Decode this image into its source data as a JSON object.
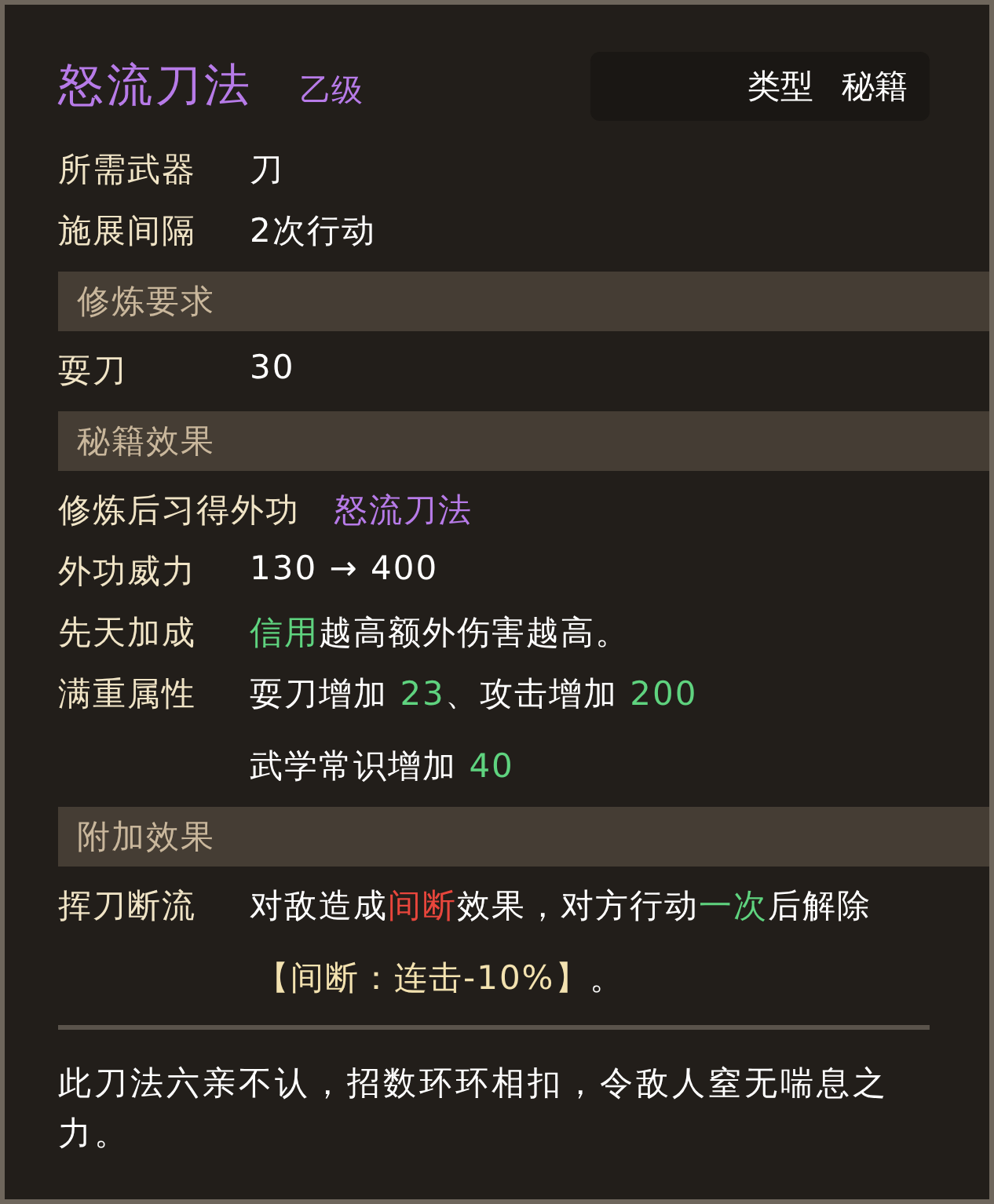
{
  "title": {
    "name": "怒流刀法",
    "grade": "乙级"
  },
  "type_chip": {
    "label": "类型",
    "value": "秘籍"
  },
  "blocks": [
    {
      "kind": "row",
      "label": "所需武器",
      "lines": [
        [
          {
            "text": "刀",
            "color": "#ffffff"
          }
        ]
      ]
    },
    {
      "kind": "row",
      "label": "施展间隔",
      "lines": [
        [
          {
            "text": "2次行动",
            "color": "#ffffff"
          }
        ]
      ]
    },
    {
      "kind": "header",
      "label": "修炼要求"
    },
    {
      "kind": "row",
      "label": "耍刀",
      "lines": [
        [
          {
            "text": "30",
            "color": "#ffffff"
          }
        ]
      ]
    },
    {
      "kind": "header",
      "label": "秘籍效果"
    },
    {
      "kind": "row",
      "label": "修炼后习得外功",
      "lines": [
        [
          {
            "text": "怒流刀法",
            "color": "#b77be8"
          }
        ]
      ]
    },
    {
      "kind": "row",
      "label": "外功威力",
      "lines": [
        [
          {
            "text": "130 → 400",
            "color": "#ffffff"
          }
        ]
      ]
    },
    {
      "kind": "row",
      "label": "先天加成",
      "lines": [
        [
          {
            "text": "信用",
            "color": "#5fd37f"
          },
          {
            "text": "越高额外伤害越高。",
            "color": "#ffffff"
          }
        ]
      ]
    },
    {
      "kind": "row",
      "label": "满重属性",
      "lines": [
        [
          {
            "text": "耍刀增加 ",
            "color": "#ffffff"
          },
          {
            "text": "23",
            "color": "#5fd37f"
          },
          {
            "text": "、攻击增加 ",
            "color": "#ffffff"
          },
          {
            "text": "200",
            "color": "#5fd37f"
          }
        ],
        [
          {
            "text": "武学常识增加 ",
            "color": "#ffffff"
          },
          {
            "text": "40",
            "color": "#5fd37f"
          }
        ]
      ]
    },
    {
      "kind": "header",
      "label": "附加效果"
    },
    {
      "kind": "row",
      "label": "挥刀断流",
      "lines": [
        [
          {
            "text": "对敌造成",
            "color": "#ffffff"
          },
          {
            "text": "间断",
            "color": "#e8463c"
          },
          {
            "text": "效果，对方行动",
            "color": "#ffffff"
          },
          {
            "text": "一次",
            "color": "#5fd37f"
          },
          {
            "text": "后解除",
            "color": "#ffffff"
          }
        ],
        [
          {
            "text": "【间断：连击-10%】",
            "color": "#f3e2b0"
          },
          {
            "text": "。",
            "color": "#ffffff"
          }
        ]
      ]
    }
  ],
  "description": "此刀法六亲不认，招数环环相扣，令敌人窒无喘息之力。"
}
